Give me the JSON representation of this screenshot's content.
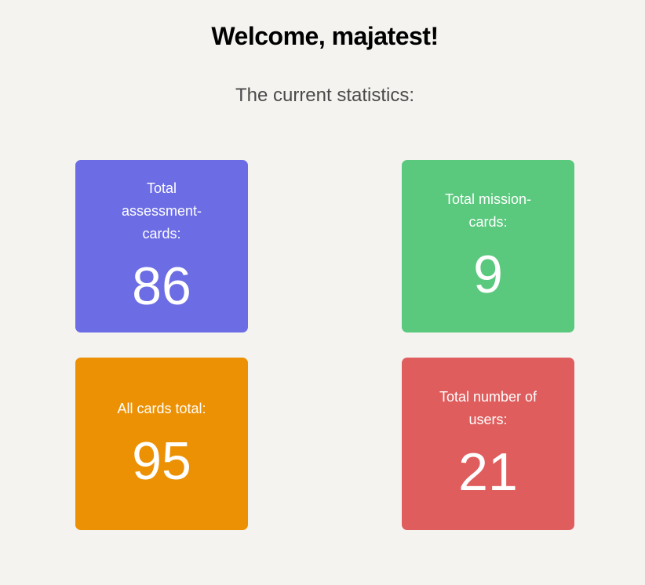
{
  "header": {
    "welcome": "Welcome, majatest!",
    "subtitle": "The current statistics:"
  },
  "stats": [
    {
      "label": "Total assessment-cards:",
      "value": "86",
      "color": "#6c6ce5"
    },
    {
      "label": "Total mission-cards:",
      "value": "9",
      "color": "#5ac87d"
    },
    {
      "label": "All cards total:",
      "value": "95",
      "color": "#ec9104"
    },
    {
      "label": "Total number of users:",
      "value": "21",
      "color": "#df5d5d"
    }
  ]
}
